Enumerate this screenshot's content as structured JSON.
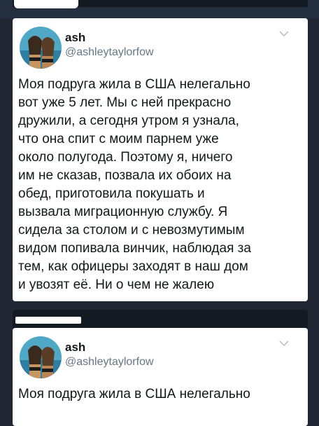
{
  "post1": {
    "name": "ash",
    "handle": "@ashleytaylorfow",
    "text": "Моя подруга жила в США нелегально\nвот уже 5 лет. Мы с ней прекрасно\nдружили,  а сегодня утром я узнала,\nчто она спит с моим парнем уже\nоколо полугода. Поэтому я, ничего\nим не сказав, позвала их обоих на\nобед, приготовила покушать и\nвызвала миграционную службу. Я\nсидела за столом и с невозмутимым\nвидом попивала винчик, наблюдая за\nтем, как офицеры заходят в наш дом\nи увозят её. Ни о чем не жалею"
  },
  "post2": {
    "name": "ash",
    "handle": "@ashleytaylorfow",
    "text": "Моя подруга жила в США нелегально"
  }
}
